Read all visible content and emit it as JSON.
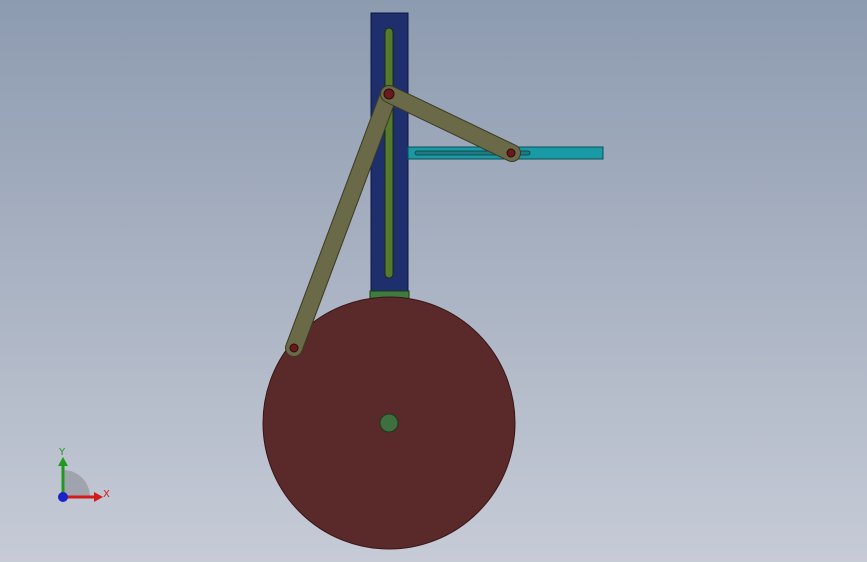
{
  "viewport": {
    "background_top": "#8d9bb0",
    "background_bottom": "#c6cbd6"
  },
  "model": {
    "parts": [
      {
        "name": "vertical-slotted-guide",
        "color": "#1f2f6e"
      },
      {
        "name": "horizontal-slotted-guide",
        "color": "#1a9aa5"
      },
      {
        "name": "crank-disk",
        "color": "#5a2a2a"
      },
      {
        "name": "connecting-rod-long",
        "color": "#6b6a48"
      },
      {
        "name": "connecting-rod-short",
        "color": "#6b6a48"
      },
      {
        "name": "slider-block",
        "color": "#3f7a3f"
      },
      {
        "name": "disk-hub-pin",
        "color": "#3f6e3f"
      }
    ]
  },
  "triad": {
    "x_label": "X",
    "y_label": "Y",
    "x_color": "#d21c1c",
    "y_color": "#1f9a1f",
    "z_color": "#1a22c8"
  }
}
